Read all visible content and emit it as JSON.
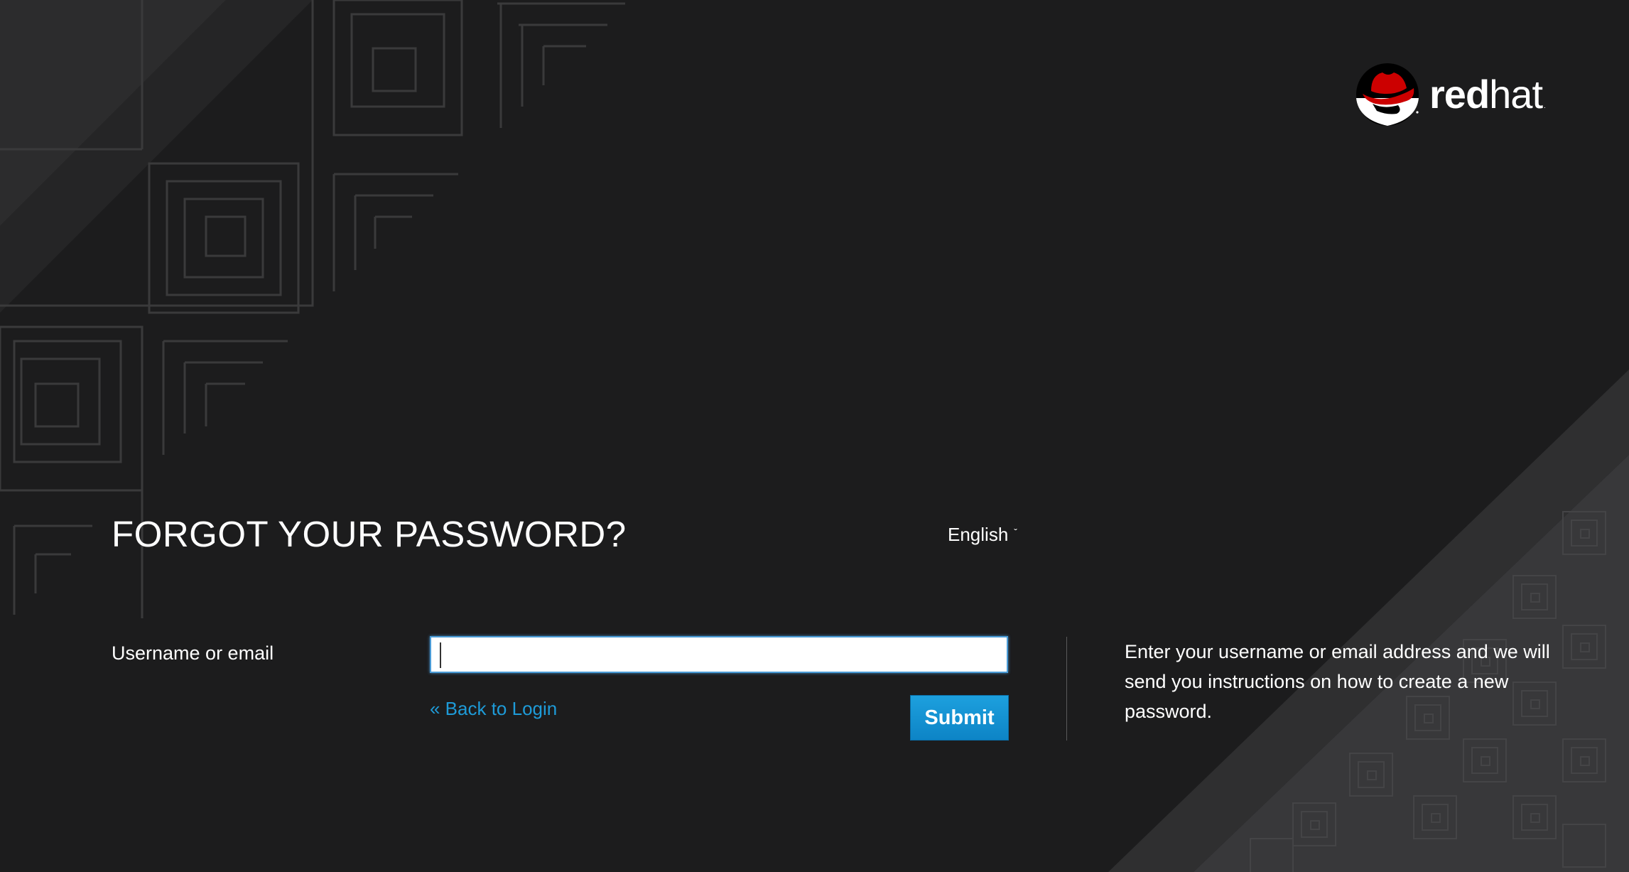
{
  "brand": {
    "name_bold": "red",
    "name_light": "hat",
    "trademark": ".",
    "logo_icon": "redhat-shadowman-icon",
    "colors": {
      "brand_red": "#cc0000",
      "link_blue": "#1e9bd8",
      "button_blue": "#0d84c6",
      "background": "#1c1c1d"
    }
  },
  "header": {
    "title": "FORGOT YOUR PASSWORD?",
    "language": {
      "selected": "English",
      "icon": "chevron-down-icon"
    }
  },
  "form": {
    "username_label": "Username or email",
    "username_value": "",
    "username_placeholder": "",
    "back_link": "« Back to Login",
    "submit_label": "Submit"
  },
  "info": {
    "text": "Enter your username or email address and we will send you instructions on how to create a new password."
  }
}
